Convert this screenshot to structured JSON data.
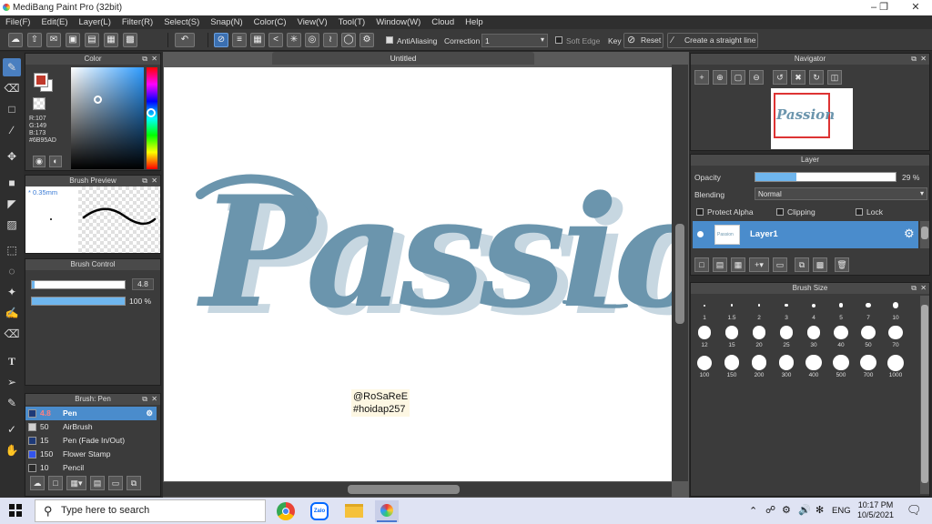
{
  "window": {
    "title": "MediBang Paint Pro (32bit)"
  },
  "menu": [
    "File(F)",
    "Edit(E)",
    "Layer(L)",
    "Filter(R)",
    "Select(S)",
    "Snap(N)",
    "Color(C)",
    "View(V)",
    "Tool(T)",
    "Window(W)",
    "Cloud",
    "Help"
  ],
  "toolbar": {
    "antialiasing_label": "AntiAliasing",
    "correction_label": "Correction",
    "correction_value": "1",
    "soft_edge_label": "Soft Edge",
    "key_label": "Key",
    "reset_label": "Reset",
    "straight_line_label": "Create a straight line"
  },
  "color_panel": {
    "title": "Color",
    "r": "R:107",
    "g": "G:149",
    "b": "B:173",
    "hex": "#6B95AD",
    "primary_color": "#c0392b",
    "secondary_color": "#ffffff"
  },
  "brush_preview": {
    "title": "Brush Preview",
    "size": "0.35mm"
  },
  "brush_control": {
    "title": "Brush Control",
    "size_value": "4.8",
    "opacity_value": "100 %",
    "size_fraction": 0.03,
    "opacity_fraction": 1.0
  },
  "brush_list": {
    "title": "Brush: Pen",
    "items": [
      {
        "size": "4.8",
        "name": "Pen",
        "color": "#1e3a78",
        "selected": true
      },
      {
        "size": "50",
        "name": "AirBrush",
        "color": "#d0d0d0",
        "selected": false
      },
      {
        "size": "15",
        "name": "Pen (Fade In/Out)",
        "color": "#1e3a78",
        "selected": false
      },
      {
        "size": "150",
        "name": "Flower Stamp",
        "color": "#3355ee",
        "selected": false
      },
      {
        "size": "10",
        "name": "Pencil",
        "color": "#2a2a2a",
        "selected": false
      }
    ]
  },
  "document": {
    "tab_title": "Untitled",
    "lettering": "Passion",
    "credit_line1": "@RoSaReE",
    "credit_line2": "#hoidap257",
    "ink_color": "#6b95ad",
    "shadow_color": "#c7d7e1"
  },
  "navigator": {
    "title": "Navigator",
    "thumb_text": "Passion"
  },
  "layer_panel": {
    "title": "Layer",
    "opacity_label": "Opacity",
    "opacity_value": "29 %",
    "opacity_fraction": 0.29,
    "blending_label": "Blending",
    "blending_value": "Normal",
    "protect_alpha": "Protect Alpha",
    "clipping": "Clipping",
    "lock": "Lock",
    "layers": [
      {
        "name": "Layer1",
        "thumb": "Passion"
      }
    ]
  },
  "brush_size": {
    "title": "Brush Size",
    "sizes": [
      "1",
      "1.5",
      "2",
      "3",
      "4",
      "5",
      "7",
      "10",
      "12",
      "15",
      "20",
      "25",
      "30",
      "40",
      "50",
      "70",
      "100",
      "150",
      "200",
      "300",
      "400",
      "500",
      "700",
      "1000"
    ]
  },
  "taskbar": {
    "search_placeholder": "Type here to search",
    "language": "ENG",
    "time": "10:17 PM",
    "date": "10/5/2021"
  }
}
